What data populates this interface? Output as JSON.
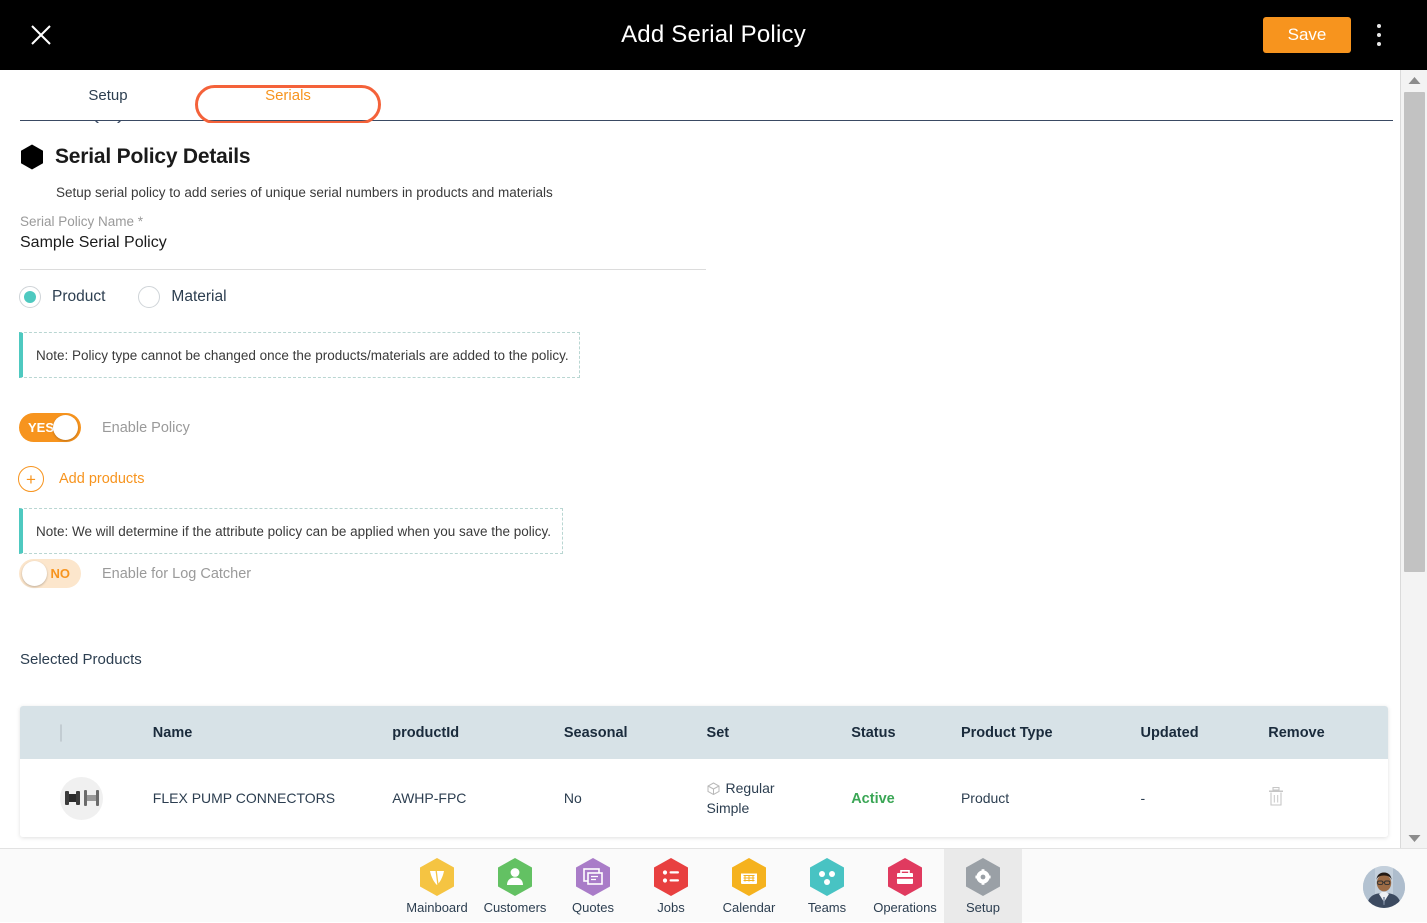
{
  "topbar": {
    "close_icon": "close-icon",
    "title": "Add Serial Policy",
    "save_label": "Save",
    "menu_icon": "kebab-menu-icon"
  },
  "tabs": [
    {
      "label": "Setup",
      "active": true
    },
    {
      "label": "Serials",
      "active": false,
      "highlighted": true
    }
  ],
  "section": {
    "icon": "hexagon-icon",
    "title": "Serial Policy Details",
    "subtitle": "Setup serial policy to add series of unique serial numbers in products and materials"
  },
  "form": {
    "name_label": "Serial Policy Name *",
    "name_value": "Sample Serial Policy",
    "radios": [
      {
        "label": "Product",
        "selected": true
      },
      {
        "label": "Material",
        "selected": false
      }
    ],
    "note_policy_type": "Note: Policy type cannot be changed once the products/materials are added to the policy.",
    "toggle_policy": {
      "state": "YES",
      "label": "Enable Policy"
    },
    "add_products_label": "Add products",
    "add_products_icon": "plus-circle-icon",
    "note_attribute": "Note: We will determine if the attribute policy can be applied when you save the policy.",
    "toggle_log": {
      "state": "NO",
      "label": "Enable for Log Catcher"
    }
  },
  "table": {
    "title": "Selected Products",
    "columns": [
      "",
      "Name",
      "productId",
      "Seasonal",
      "Set",
      "Status",
      "Product Type",
      "Updated",
      "Remove"
    ],
    "rows": [
      {
        "thumb": "product-thumbnail",
        "name": "FLEX PUMP CONNECTORS",
        "productId": "AWHP-FPC",
        "seasonal": "No",
        "set_line1": "Regular",
        "set_line2": "Simple",
        "set_icon": "box-icon",
        "status": "Active",
        "product_type": "Product",
        "updated": "-",
        "remove_icon": "trash-icon"
      }
    ]
  },
  "scrollbar": {
    "up_icon": "scroll-up-arrow-icon",
    "down_icon": "scroll-down-arrow-icon"
  },
  "bottomnav": {
    "items": [
      {
        "label": "Mainboard",
        "icon": "mainboard-icon",
        "color": "#f5c442",
        "active": false
      },
      {
        "label": "Customers",
        "icon": "customers-icon",
        "color": "#63c163",
        "active": false
      },
      {
        "label": "Quotes",
        "icon": "quotes-icon",
        "color": "#a97cc8",
        "active": false
      },
      {
        "label": "Jobs",
        "icon": "jobs-icon",
        "color": "#e84040",
        "active": false
      },
      {
        "label": "Calendar",
        "icon": "calendar-icon",
        "color": "#f5b21e",
        "active": false
      },
      {
        "label": "Teams",
        "icon": "teams-icon",
        "color": "#48c3c3",
        "active": false
      },
      {
        "label": "Operations",
        "icon": "operations-icon",
        "color": "#e03a5f",
        "active": false
      },
      {
        "label": "Setup",
        "icon": "gear-icon",
        "color": "#9aa0a6",
        "active": true
      }
    ],
    "avatar": "user-avatar"
  },
  "colors": {
    "accent_orange": "#f7941e",
    "highlight_orange": "#f4623a",
    "teal": "#4ec9c0",
    "status_green": "#3aa655",
    "header_bg": "#d7e2e7",
    "topbar_bg": "#000000"
  }
}
